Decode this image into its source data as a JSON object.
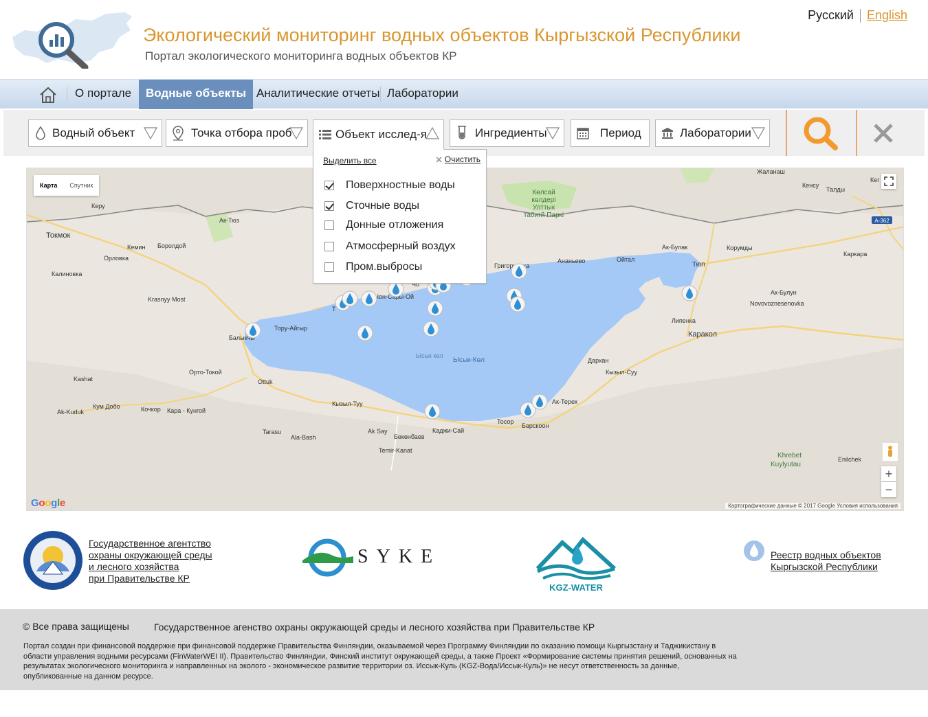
{
  "header": {
    "title": "Экологический мониторинг водных объектов Кыргызской Республики",
    "subtitle": "Портал экологического мониторинга водных объектов КР",
    "languages": [
      "Русский",
      "English"
    ],
    "active_language": "English"
  },
  "nav": {
    "items": [
      "О портале",
      "Водные объекты",
      "Аналитические отчеты",
      "Лаборатории"
    ],
    "active": "Водные объекты"
  },
  "filters": {
    "water_object": "Водный объект",
    "sampling_point": "Точка отбора проб",
    "research_object": "Объект исслед-я",
    "ingredients": "Ингредиенты",
    "period": "Период",
    "laboratories": "Лаборатории"
  },
  "dropdown": {
    "select_all": "Выделить все",
    "clear": "Очистить",
    "options": [
      {
        "label": "Поверхностные воды",
        "checked": true
      },
      {
        "label": "Сточные воды",
        "checked": true
      },
      {
        "label": "Донные отложения",
        "checked": false
      },
      {
        "label": "Атмосферный воздух",
        "checked": false
      },
      {
        "label": "Пром.выбросы",
        "checked": false
      }
    ]
  },
  "map": {
    "type_buttons": [
      "Карта",
      "Спутник"
    ],
    "active_type": "Карта",
    "attribution": "Картографические данные © 2017 Google  Условия использования",
    "google_logo": "Google",
    "lake_labels": [
      "Ысык-Көл",
      "Ысык көл"
    ],
    "park_label": [
      "Көлсай",
      "көлдері",
      "Улттык",
      "табигй Паркі"
    ],
    "road_badge": "A-362",
    "places": [
      "Жаланаш",
      "Кенсу",
      "Талды",
      "Кег",
      "Керу",
      "Ак-Тюз",
      "Токмок",
      "Кемин",
      "Боролдой",
      "Орловка",
      "Калиновка",
      "Krasnyy Most",
      "Григорьевка",
      "Ананьево",
      "Ойтал",
      "Ак-Булак",
      "Корумды",
      "Тюп",
      "Каркара",
      "Ак-Булун",
      "Novovoznesenovka",
      "Липенка",
      "Каракол",
      "Тору-Айгыр",
      "Балыкчы",
      "Чон-Сары-Ой",
      "Чо",
      "Т",
      "Орто-Токой",
      "Ottuk",
      "Kashat",
      "Ak-Kuduk",
      "Кум Добо",
      "Кочкор",
      "Кара - Кунгой",
      "Кызыл-Туу",
      "Ak Say",
      "Каджи-Сай",
      "Тосор",
      "Барскоон",
      "Ак-Терек",
      "Дархан",
      "Кызыл-Суу",
      "Tarasu",
      "Ala-Bash",
      "Бөкөнбаев",
      "Temir-Kanat",
      "Khrebet",
      "Kuylyutau",
      "Enilchek"
    ]
  },
  "partners": {
    "agency_link": [
      "Государственное агентство",
      "охраны окружающей среды",
      "и лесного хозяйства",
      "при Правительстве КР"
    ],
    "syke": "SYKE",
    "kgz_water": "KGZ-WATER",
    "registry_link": [
      "Реестр водных объектов",
      "Кыргызской Республики"
    ]
  },
  "footer": {
    "copyright": "© Все права защищены",
    "agency": "Государственное агенство охраны окружающей среды и лесного хозяйства при Правительстве КР",
    "disclaimer": "Портал создан при финансовой поддержке при финансовой поддержке Правительства Финляндии, оказываемой через Программу Финляндии по оказанию помощи Кыргызстану и Таджикистану в области управления водными ресурсами (FinWaterWEI II). Правительство Финляндии, Финский институт окружающей среды, а также Проект «Формирование системы принятия решений, основанных на результатах экологического мониторинга и направленных на эколого - экономическое развитие территории оз. Иссык-Куль (KGZ-Вода/Иссык-Куль)» не несут ответственность за данные, опубликованные на данном ресурсе."
  },
  "colors": {
    "accent_orange": "#d9962f",
    "nav_active": "#6b8fbd",
    "lake": "#a4c9f6",
    "marker": "#2f8fd4"
  }
}
